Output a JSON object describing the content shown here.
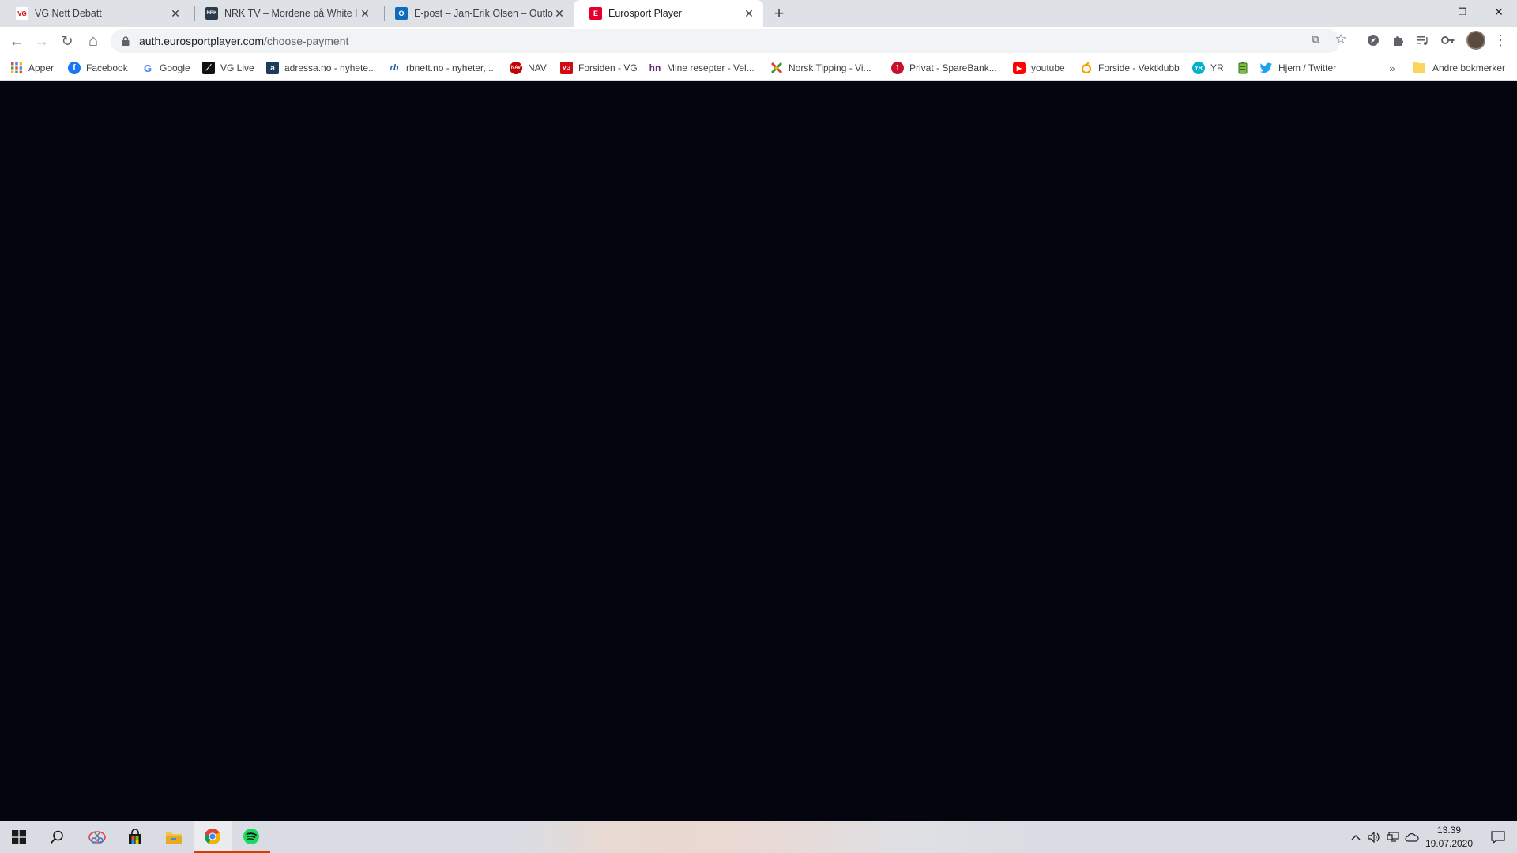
{
  "browser": {
    "tabs": [
      {
        "title": "VG Nett Debatt",
        "favicon": "vg-icon",
        "active": false
      },
      {
        "title": "NRK TV – Mordene på White Hou",
        "favicon": "nrk-tv-icon",
        "active": false
      },
      {
        "title": "E-post – Jan-Erik Olsen – Outlook",
        "favicon": "outlook-icon",
        "active": false
      },
      {
        "title": "Eurosport Player",
        "favicon": "eurosport-icon",
        "active": true
      }
    ],
    "new_tab_symbol": "+",
    "window_controls": {
      "minimize": "–",
      "restore": "❐",
      "close": "✕"
    }
  },
  "toolbar": {
    "back_symbol": "←",
    "forward_symbol": "→",
    "reload_symbol": "↻",
    "home_symbol": "⌂",
    "url_host": "auth.eurosportplayer.com",
    "url_path": "/choose-payment",
    "translate_symbol": "⧉",
    "bookmark_star_symbol": "☆",
    "extensions": [
      "compass-icon",
      "puzzle-icon",
      "media-queue-icon",
      "key-icon"
    ],
    "menu_symbol": "⋮"
  },
  "bookmarks": {
    "items": [
      {
        "label": "Apper",
        "icon": "apps-grid-icon"
      },
      {
        "label": "Facebook",
        "icon": "facebook-icon"
      },
      {
        "label": "Google",
        "icon": "google-icon"
      },
      {
        "label": "VG Live",
        "icon": "vg-live-icon"
      },
      {
        "label": "adressa.no - nyhete...",
        "icon": "adressa-icon"
      },
      {
        "label": "rbnett.no - nyheter,...",
        "icon": "rbnett-icon"
      },
      {
        "label": "NAV",
        "icon": "nav-icon"
      },
      {
        "label": "Forsiden - VG",
        "icon": "vg-icon"
      },
      {
        "label": "Mine resepter - Vel...",
        "icon": "hn-icon"
      },
      {
        "label": "Norsk Tipping - Vi...",
        "icon": "norsk-tipping-icon"
      },
      {
        "label": "Privat - SpareBank...",
        "icon": "sparebank-icon"
      },
      {
        "label": "youtube",
        "icon": "youtube-icon"
      },
      {
        "label": "Forside - Vektklubb",
        "icon": "vektklubb-icon"
      },
      {
        "label": "YR",
        "icon": "yr-icon"
      },
      {
        "label": "",
        "icon": "battery-bookmark-icon"
      },
      {
        "label": "Hjem / Twitter",
        "icon": "twitter-icon"
      }
    ],
    "more_symbol": "»",
    "other_label": "Andre bokmerker"
  },
  "taskbar": {
    "apps": [
      "windows-start-icon",
      "search-icon",
      "snipping-tool-icon",
      "store-icon",
      "file-explorer-icon",
      "chrome-icon",
      "spotify-icon"
    ],
    "tray_chevron": "^",
    "time": "13.39",
    "date": "19.07.2020"
  },
  "colors": {
    "page_background": "#05050f",
    "tabstrip": "#dee1e6",
    "accent_running": "#d83b01"
  }
}
